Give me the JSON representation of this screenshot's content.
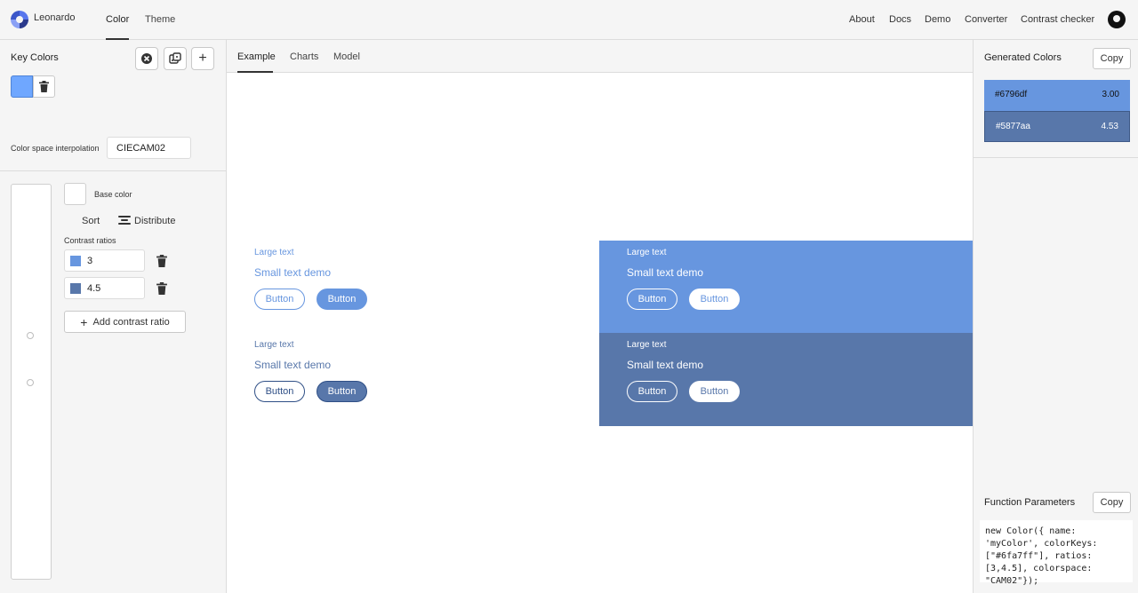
{
  "topnav": {
    "brand": "Leonardo",
    "tabs": [
      {
        "label": "Color"
      },
      {
        "label": "Theme"
      }
    ],
    "links": [
      {
        "label": "About"
      },
      {
        "label": "Docs"
      },
      {
        "label": "Demo"
      },
      {
        "label": "Converter"
      },
      {
        "label": "Contrast checker"
      }
    ]
  },
  "left": {
    "key_colors_title": "Key Colors",
    "key_color_value": "#6fa7ff",
    "csi_label": "Color space interpolation",
    "csi_value": "CIECAM02",
    "base_color_label": "Base color",
    "sort_label": "Sort",
    "distribute_label": "Distribute",
    "contrast_ratios_label": "Contrast ratios",
    "ratios": [
      {
        "value": "3",
        "color": "#6796df"
      },
      {
        "value": "4.5",
        "color": "#5877aa"
      }
    ],
    "add_ratio_label": "Add contrast ratio"
  },
  "main": {
    "tabs": [
      {
        "label": "Example"
      },
      {
        "label": "Charts"
      },
      {
        "label": "Model"
      }
    ],
    "demo": {
      "large_text": "Large text",
      "small_text": "Small text demo",
      "button_label": "Button"
    }
  },
  "right": {
    "generated_title": "Generated Colors",
    "copy_label": "Copy",
    "generated": [
      {
        "hex": "#6796df",
        "ratio": "3.00"
      },
      {
        "hex": "#5877aa",
        "ratio": "4.53"
      }
    ],
    "params_title": "Function Parameters",
    "params_code": "new Color({ name: 'myColor', colorKeys: [\"#6fa7ff\"], ratios: [3,4.5], colorspace: \"CAM02\"});"
  },
  "colors": {
    "c1": "#6796df",
    "c2": "#5877aa",
    "key": "#6fa7ff"
  }
}
